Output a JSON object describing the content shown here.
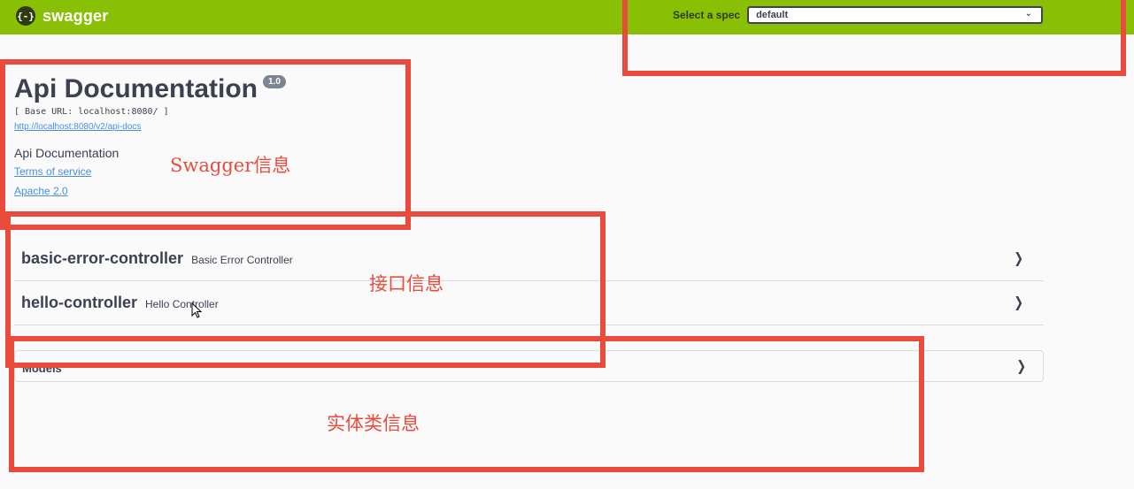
{
  "topbar": {
    "logo_icon": "{-}",
    "logo_text": "swagger",
    "spec_label": "Select a spec",
    "spec_value": "default",
    "brand_color": "#89bf04"
  },
  "info": {
    "title": "Api Documentation",
    "version": "1.0",
    "base_url": "[ Base URL: localhost:8080/ ]",
    "api_docs_link": "http://localhost:8080/v2/api-docs",
    "description": "Api Documentation",
    "terms_link": "Terms of service",
    "license_link": "Apache 2.0"
  },
  "tags": [
    {
      "name": "basic-error-controller",
      "description": "Basic Error Controller"
    },
    {
      "name": "hello-controller",
      "description": "Hello Controller"
    }
  ],
  "models": {
    "title": "Models"
  },
  "annotations": {
    "swagger_info": "Swagger信息",
    "interface_info": "接口信息",
    "entity_info": "实体类信息",
    "color": "#e94b3c"
  },
  "icons": {
    "chevron_down": "chevron-down-icon",
    "chevron_right": "chevron-right-icon",
    "cursor": "mouse-cursor-icon"
  }
}
